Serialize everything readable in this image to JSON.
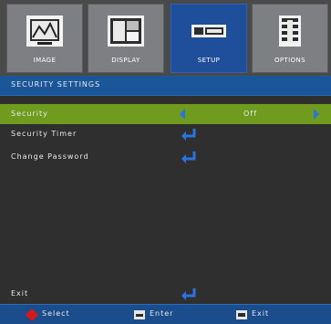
{
  "tabs": [
    {
      "label": "IMAGE",
      "icon": "monitor-image-icon",
      "active": false
    },
    {
      "label": "DISPLAY",
      "icon": "display-icon",
      "active": false
    },
    {
      "label": "SETUP",
      "icon": "setup-icon",
      "active": true
    },
    {
      "label": "OPTIONS",
      "icon": "options-icon",
      "active": false
    }
  ],
  "title": "SECURITY SETTINGS",
  "items": [
    {
      "name": "Security",
      "type": "toggle",
      "value": "Off",
      "selected": true
    },
    {
      "name": "Security Timer",
      "type": "enter",
      "selected": false
    },
    {
      "name": "Change Password",
      "type": "enter",
      "selected": false
    }
  ],
  "exit_label": "Exit",
  "hints": [
    {
      "icon": "diamond-dpad-icon",
      "label": "Select"
    },
    {
      "icon": "enter-key-icon",
      "label": "Enter"
    },
    {
      "icon": "menu-key-icon",
      "label": "Exit"
    }
  ],
  "colors": {
    "active_tab": "#1f4f9a",
    "selected_row": "#6f9b1f",
    "title_bar": "#1b5698",
    "icon_blue": "#2a72e0",
    "select_icon": "#d81818"
  }
}
